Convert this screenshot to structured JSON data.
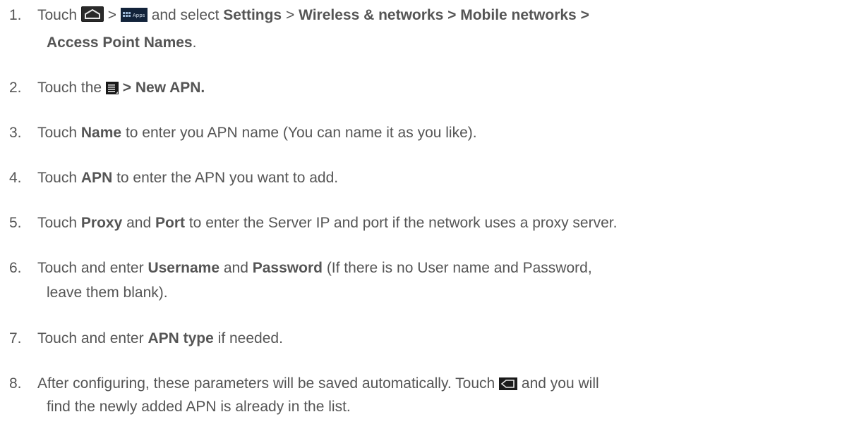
{
  "steps": [
    {
      "number": "1.",
      "t1": "Touch",
      "sep1": ">",
      "t2": "and select",
      "b1": "Settings",
      "sep2": ">",
      "b2": "Wireless & networks > Mobile networks >",
      "b3": "Access Point Names",
      "end": ".",
      "home_icon": "home-icon",
      "apps_icon": "apps-icon",
      "apps_icon_text": "Apps"
    },
    {
      "number": "2.",
      "t1": "Touch the",
      "b1": "> New APN.",
      "menu_icon": "menu-icon"
    },
    {
      "number": "3.",
      "t1": "Touch",
      "b1": "Name",
      "t2": "to enter you APN name (You can name it as you like)."
    },
    {
      "number": "4.",
      "t1": "Touch",
      "b1": "APN",
      "t2": "to enter the APN you want to add."
    },
    {
      "number": "5.",
      "t1": "Touch",
      "b1": "Proxy",
      "t2": "and",
      "b2": "Port",
      "t3": "to enter the Server IP and port if the network uses a proxy server."
    },
    {
      "number": "6.",
      "t1": "Touch and enter",
      "b1": "Username",
      "t2": "and",
      "b2": "Password",
      "t3": "(If there is no User name and Password,",
      "t4": "leave them blank)."
    },
    {
      "number": "7.",
      "t1": "Touch and enter",
      "b1": "APN type",
      "t2": "if needed."
    },
    {
      "number": "8.",
      "t1": "After configuring, these parameters will be saved automatically. Touch",
      "t2": "and you will",
      "t3": "find the newly added APN is already in the list.",
      "back_icon": "back-icon"
    }
  ],
  "colors": {
    "text": "#555555",
    "icon_bg": "#1a1a1a",
    "icon_accent": "#3b82c4"
  }
}
